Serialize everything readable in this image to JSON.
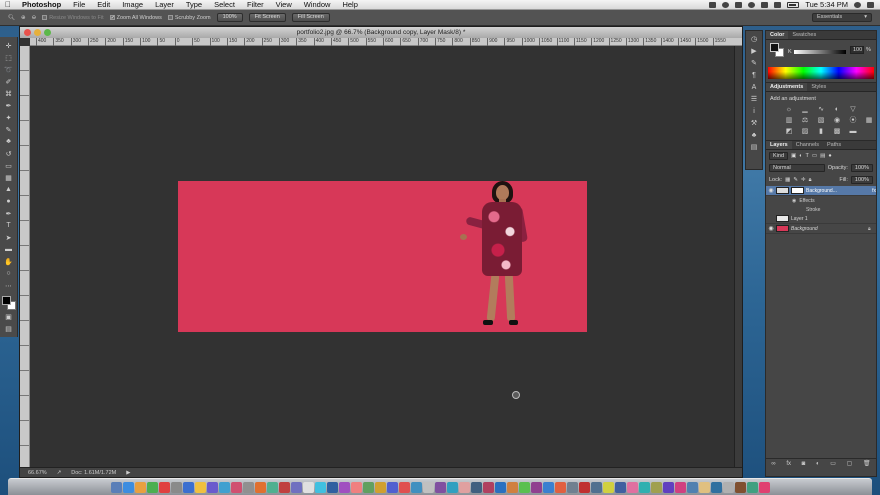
{
  "menubar": {
    "app": "Photoshop",
    "items": [
      "File",
      "Edit",
      "Image",
      "Layer",
      "Type",
      "Select",
      "Filter",
      "View",
      "Window",
      "Help"
    ],
    "clock": "Tue 5:34 PM"
  },
  "options": {
    "resize_windows": "Resize Windows to Fit",
    "zoom_all": "Zoom All Windows",
    "scrubby_zoom": "Scrubby Zoom",
    "btn_100": "100%",
    "btn_fit": "Fit Screen",
    "btn_fill": "Fill Screen",
    "workspace": "Essentials"
  },
  "document": {
    "title": "portfolio2.jpg @ 66.7% (Background copy, Layer Mask/8) *",
    "ruler_ticks": [
      "400",
      "350",
      "300",
      "250",
      "200",
      "150",
      "100",
      "50",
      "0",
      "50",
      "100",
      "150",
      "200",
      "250",
      "300",
      "350",
      "400",
      "450",
      "500",
      "550",
      "600",
      "650",
      "700",
      "750",
      "800",
      "850",
      "900",
      "950",
      "1000",
      "1050",
      "1100",
      "1150",
      "1200",
      "1250",
      "1300",
      "1350",
      "1400",
      "1450",
      "1500",
      "1550"
    ],
    "zoom": "66.67%",
    "doc_size": "Doc: 1.61M/1.72M",
    "image_color": "#d73858"
  },
  "color_panel": {
    "tabs": [
      "Color",
      "Swatches"
    ],
    "channel": "K",
    "value": "100",
    "unit": "%"
  },
  "adjustments": {
    "tabs": [
      "Adjustments",
      "Styles"
    ],
    "heading": "Add an adjustment"
  },
  "layers_panel": {
    "tabs": [
      "Layers",
      "Channels",
      "Paths"
    ],
    "kind": "Kind",
    "blend_mode": "Normal",
    "opacity_label": "Opacity:",
    "opacity": "100%",
    "lock_label": "Lock:",
    "fill_label": "Fill:",
    "fill": "100%",
    "layers": [
      {
        "name": "Background...",
        "fx": "fx",
        "selected": true
      },
      {
        "name": "Layer 1"
      },
      {
        "name": "Background"
      }
    ],
    "effects_label": "Effects",
    "stroke_label": "Stroke"
  },
  "colors": {
    "dock": [
      "#5a7fb8",
      "#3d8de0",
      "#e8a040",
      "#4caf50",
      "#e04040",
      "#8a8a8a",
      "#3b6fd0",
      "#f0c040",
      "#6a5acd",
      "#40a0d0",
      "#d05070",
      "#909090",
      "#e07030",
      "#50b090",
      "#c04040",
      "#7070c0",
      "#e0e0e0",
      "#40c0e0",
      "#3060a0",
      "#a050c0",
      "#f08080",
      "#60a060",
      "#d0a030",
      "#5060d0",
      "#e05050",
      "#4090c0",
      "#c0c0c0",
      "#8050a0",
      "#30a0c0",
      "#e0a0a0",
      "#406080",
      "#b04060",
      "#2a70c0",
      "#d08040",
      "#5ac050",
      "#904090",
      "#3a80d0",
      "#e06040",
      "#708090",
      "#c03030",
      "#507090",
      "#d0d040",
      "#4060a0",
      "#e070a0",
      "#30b0b0",
      "#a0a050",
      "#6040c0",
      "#d04080",
      "#5080b0",
      "#e0c080",
      "#3070a0",
      "#b0b0b0",
      "#805030",
      "#40a080",
      "#e04070"
    ]
  }
}
